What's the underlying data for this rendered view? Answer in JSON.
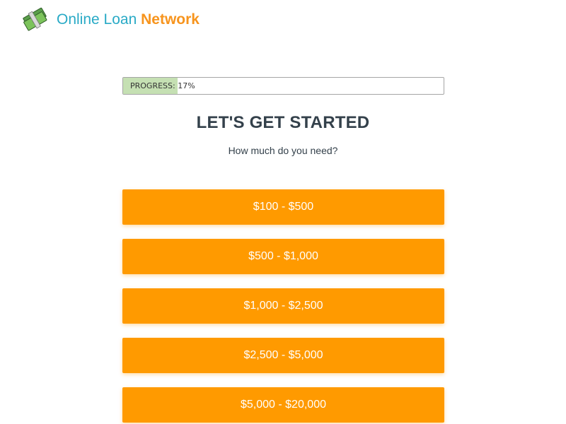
{
  "brand": {
    "name_part1": "Online Loan",
    "name_part2": "Network",
    "logo_icon": "money-stack-icon",
    "colors": {
      "primary": "#29aac6",
      "accent": "#f7941d"
    }
  },
  "progress": {
    "label": "PROGRESS: 17%",
    "percent": 17,
    "fill_color": "#c5e0b3"
  },
  "heading": "LET'S GET STARTED",
  "question": "How much do you need?",
  "options": [
    "$100 - $500",
    "$500 - $1,000",
    "$1,000 - $2,500",
    "$2,500 - $5,000",
    "$5,000 - $20,000"
  ],
  "button_color": "#ff9a00"
}
